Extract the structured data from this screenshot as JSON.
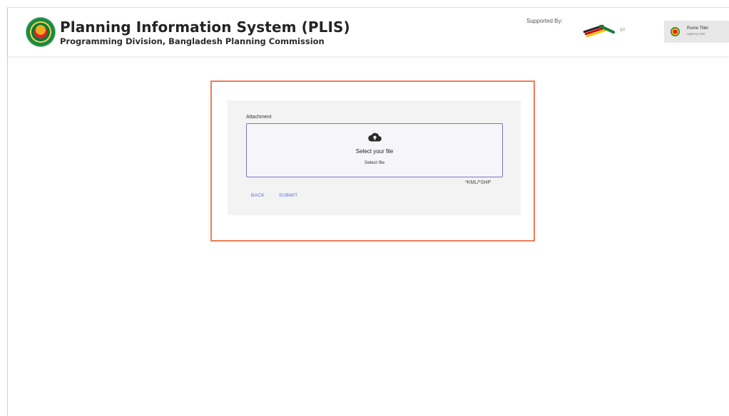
{
  "header": {
    "title": "Planning Information System (PLIS)",
    "subtitle": "Programming Division, Bangladesh Planning Commission",
    "supported_by": "Supported By:",
    "sponsor_logos": [
      "german-cooperation-logo",
      "giz-logo"
    ],
    "giz_text": "giz",
    "user": {
      "name": "Rume Tiller",
      "role": "Agency User"
    }
  },
  "form": {
    "attachment_label": "Attachment",
    "dropzone_title": "Select your file",
    "dropzone_subtitle": "Select file",
    "accepted_formats": "*KML/*SHP",
    "back_label": "BACK",
    "submit_label": "SUBMIT"
  },
  "colors": {
    "card_border": "#ef7d57",
    "link": "#5b6bd6",
    "dropzone_border": "#7b74c9"
  }
}
